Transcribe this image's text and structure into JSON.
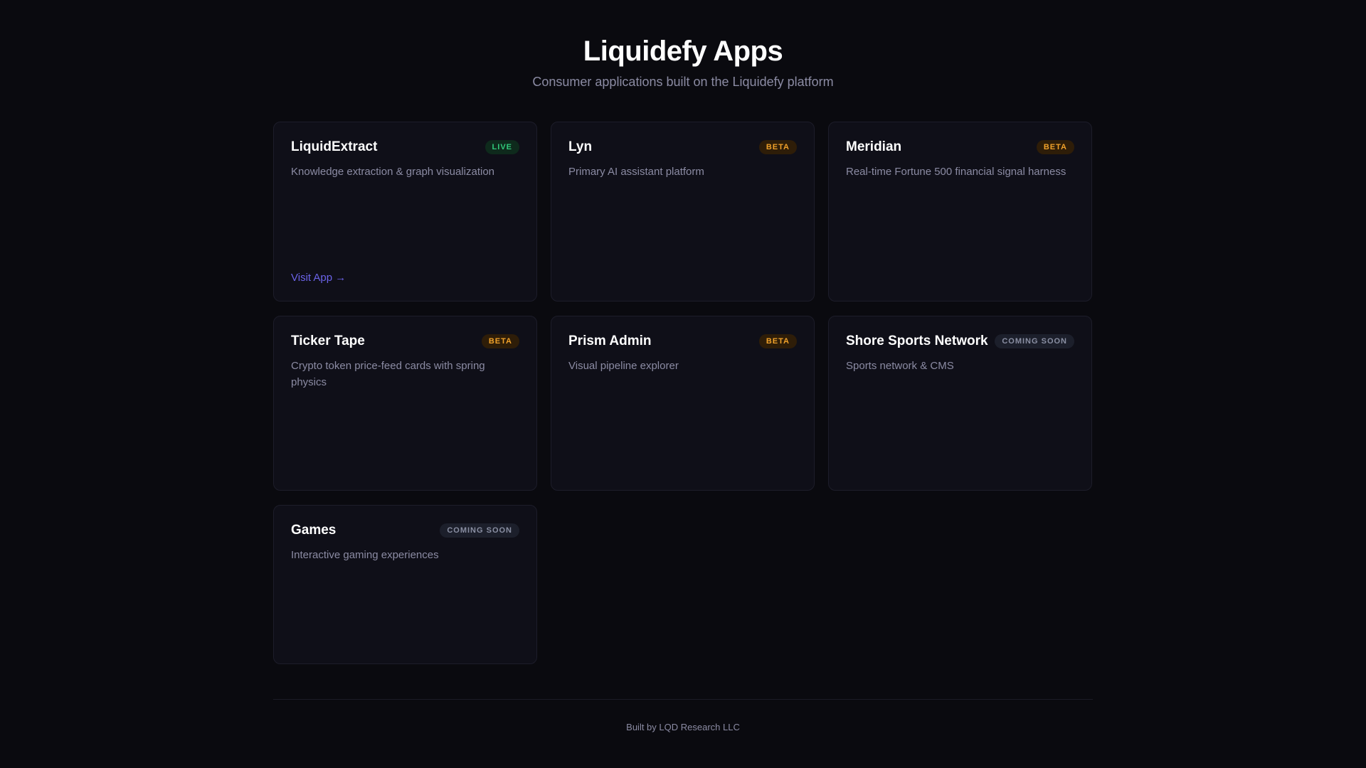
{
  "header": {
    "title": "Liquidefy Apps",
    "subtitle": "Consumer applications built on the Liquidefy platform"
  },
  "cards": [
    {
      "name": "LiquidExtract",
      "badge": "LIVE",
      "badge_type": "live",
      "description": "Knowledge extraction & graph visualization",
      "link": "Visit App →"
    },
    {
      "name": "Lyn",
      "badge": "BETA",
      "badge_type": "beta",
      "description": "Primary AI assistant platform"
    },
    {
      "name": "Meridian",
      "badge": "BETA",
      "badge_type": "beta",
      "description": "Real-time Fortune 500 financial signal harness"
    },
    {
      "name": "Ticker Tape",
      "badge": "BETA",
      "badge_type": "beta",
      "description": "Crypto token price-feed cards with spring physics"
    },
    {
      "name": "Prism Admin",
      "badge": "BETA",
      "badge_type": "beta",
      "description": "Visual pipeline explorer"
    },
    {
      "name": "Shore Sports Network",
      "badge": "COMING SOON",
      "badge_type": "soon",
      "description": "Sports network & CMS"
    },
    {
      "name": "Games",
      "badge": "COMING SOON",
      "badge_type": "soon",
      "description": "Interactive gaming experiences"
    }
  ],
  "footer": {
    "text": "Built by LQD Research LLC"
  },
  "colors": {
    "background": "#0a0a0f",
    "card": "#0f0f18",
    "live": "#31c97a",
    "beta": "#f0a12a",
    "soon": "#8a8fa3",
    "link": "#6b63e8"
  }
}
